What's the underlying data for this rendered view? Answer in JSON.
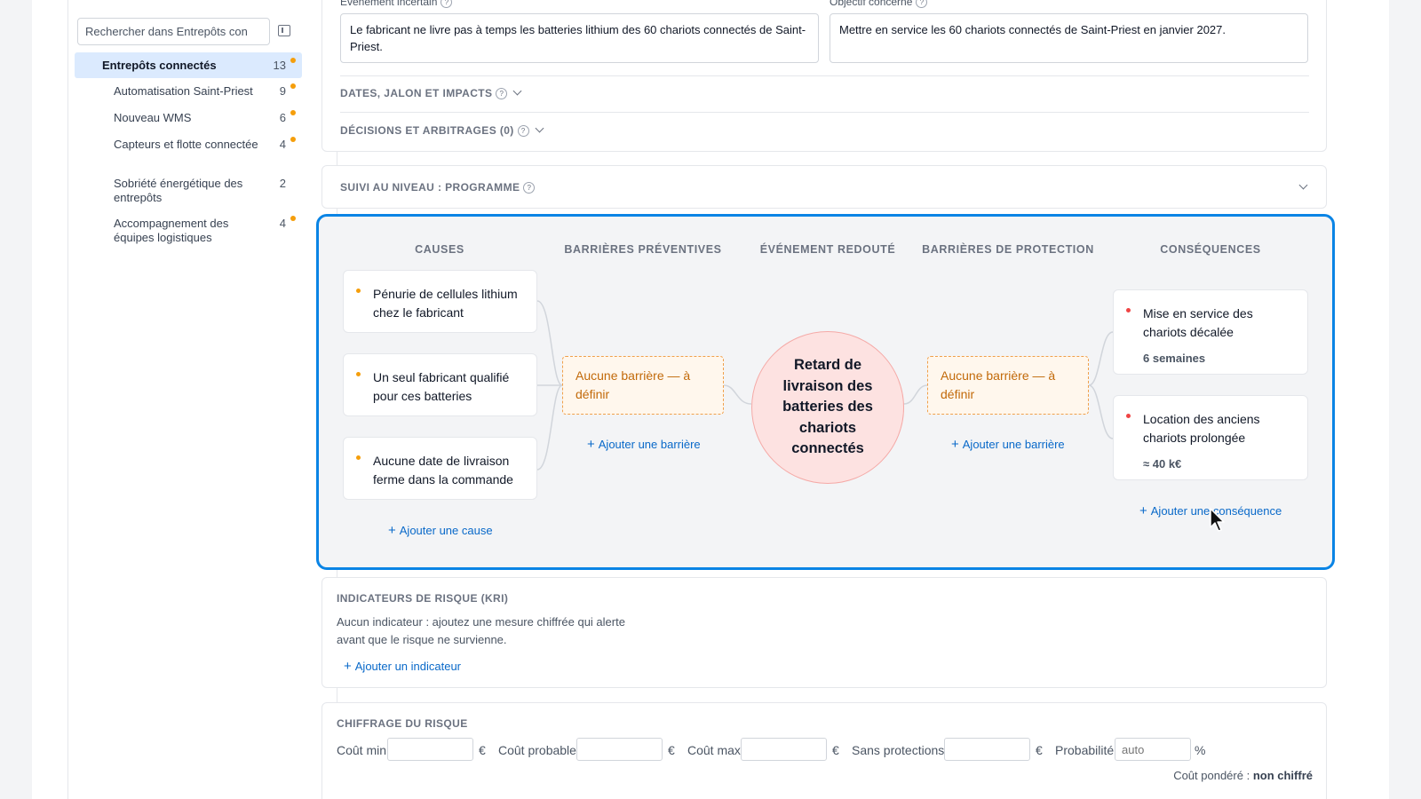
{
  "sidebar": {
    "search_placeholder": "Rechercher dans Entrepôts con",
    "items": [
      {
        "label": "Entrepôts connectés",
        "count": "13"
      },
      {
        "label": "Automatisation Saint-Priest",
        "count": "9"
      },
      {
        "label": "Nouveau WMS",
        "count": "6"
      },
      {
        "label": "Capteurs et flotte connectée",
        "count": "4"
      },
      {
        "label": "Sobriété énergétique des entrepôts",
        "count": "2"
      },
      {
        "label": "Accompagnement des équipes logistiques",
        "count": "4"
      }
    ]
  },
  "risk": {
    "event_label": "Événement incertain",
    "event_text": "Le fabricant ne livre pas à temps les batteries lithium des 60 chariots connectés de Saint-Priest.",
    "objective_label": "Objectif concerné",
    "objective_text": "Mettre en service les 60 chariots connectés de Saint-Priest en janvier 2027.",
    "dates_title": "DATES, JALON ET IMPACTS",
    "decisions_title": "DÉCISIONS ET ARBITRAGES (0)",
    "help_icon": "?",
    "followup_title": "SUIVI AU NIVEAU : PROGRAMME"
  },
  "bowtie": {
    "headers": {
      "causes": "CAUSES",
      "preventive": "BARRIÈRES PRÉVENTIVES",
      "event": "ÉVÉNEMENT REDOUTÉ",
      "protection": "BARRIÈRES DE PROTECTION",
      "consequences": "CONSÉQUENCES"
    },
    "causes": [
      {
        "text": "Pénurie de cellules lithium chez le fabricant"
      },
      {
        "text": "Un seul fabricant qualifié pour ces batteries"
      },
      {
        "text": "Aucune date de livraison ferme dans la commande"
      }
    ],
    "add_cause": "Ajouter une cause",
    "preventive_barrier": "Aucune barrière — à définir",
    "add_preventive": "Ajouter une barrière",
    "event": "Retard de livraison des batteries des chariots connectés",
    "protection_barrier": "Aucune barrière — à définir",
    "add_protection": "Ajouter une barrière",
    "consequences": [
      {
        "text": "Mise en service des chariots décalée",
        "impact": "6 semaines"
      },
      {
        "text": "Location des anciens chariots prolongée",
        "impact": "≈ 40 k€"
      }
    ],
    "add_consequence": "Ajouter une conséquence",
    "colors": {
      "cause_dot": "#f59e0b",
      "consequence_dot": "#ef4444",
      "frame": "#0a84e5"
    }
  },
  "kri": {
    "title": "INDICATEURS DE RISQUE (KRI)",
    "empty_text": "Aucun indicateur : ajoutez une mesure chiffrée qui alerte avant que le risque ne survienne.",
    "add": "Ajouter un indicateur"
  },
  "costing": {
    "title": "CHIFFRAGE DU RISQUE",
    "min_label": "Coût min",
    "probable_label": "Coût probable",
    "max_label": "Coût max",
    "unprotected_label": "Sans protections",
    "currency": "€",
    "probability_label": "Probabilité",
    "probability_value": "auto",
    "percent": "%",
    "weighted_label": "Coût pondéré :",
    "weighted_value": "non chiffré"
  }
}
